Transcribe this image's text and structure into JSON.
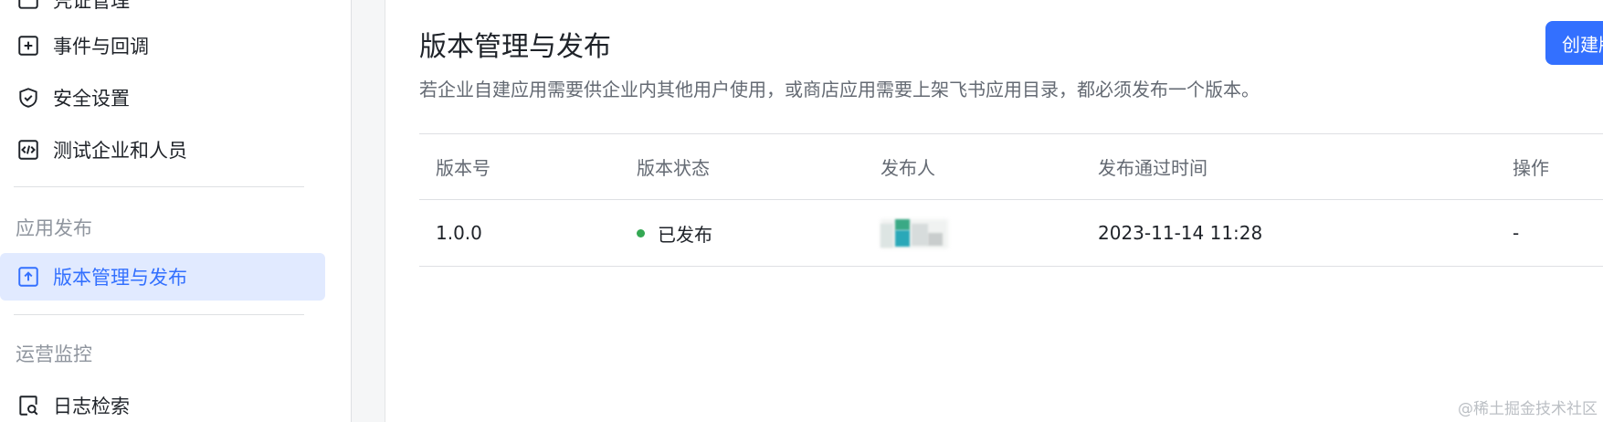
{
  "sidebar": {
    "items": [
      {
        "label": "凭证管理"
      },
      {
        "label": "事件与回调"
      },
      {
        "label": "安全设置"
      },
      {
        "label": "测试企业和人员"
      }
    ],
    "sections": [
      {
        "title": "应用发布",
        "items": [
          {
            "label": "版本管理与发布"
          }
        ]
      },
      {
        "title": "运营监控",
        "items": [
          {
            "label": "日志检索"
          }
        ]
      }
    ]
  },
  "main": {
    "title": "版本管理与发布",
    "description": "若企业自建应用需要供企业内其他用户使用，或商店应用需要上架飞书应用目录，都必须发布一个版本。",
    "create_button": "创建版本"
  },
  "table": {
    "columns": [
      "版本号",
      "版本状态",
      "发布人",
      "发布通过时间",
      "操作"
    ],
    "rows": [
      {
        "version": "1.0.0",
        "status": "已发布",
        "publisher": "",
        "time": "2023-11-14 11:28",
        "action": "-"
      }
    ]
  },
  "colors": {
    "accent": "#3370ff",
    "status_published": "#34a853"
  },
  "watermark": "@稀土掘金技术社区"
}
